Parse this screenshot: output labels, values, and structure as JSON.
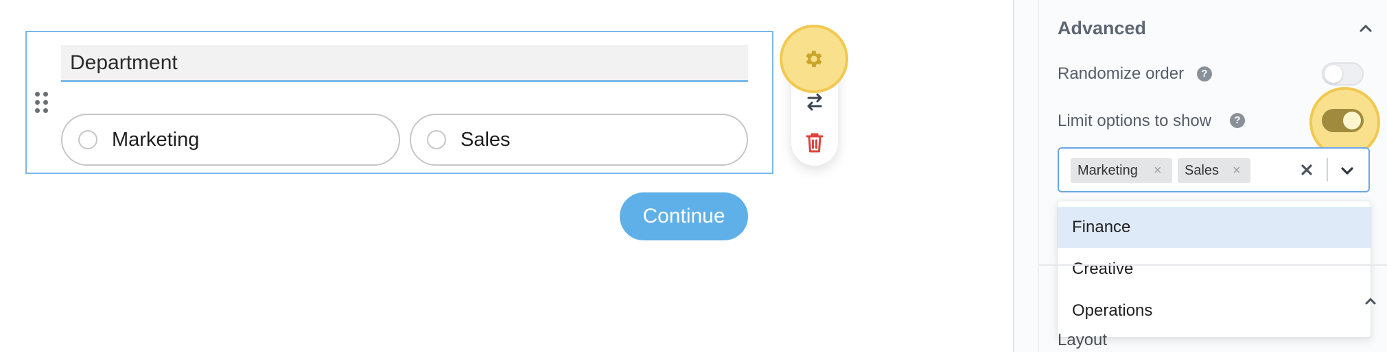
{
  "editor": {
    "question_title": "Department",
    "options": [
      "Marketing",
      "Sales"
    ],
    "continue_label": "Continue"
  },
  "toolbar": {
    "icons": [
      "gear-icon",
      "swap-icon",
      "trash-icon"
    ]
  },
  "panel": {
    "section_title": "Advanced",
    "randomize_label": "Randomize order",
    "randomize_enabled": false,
    "limit_label": "Limit options to show",
    "limit_enabled": true,
    "help_glyph": "?",
    "selected_chips": [
      "Marketing",
      "Sales"
    ],
    "chip_remove_glyph": "×",
    "dropdown_options": [
      "Finance",
      "Creative",
      "Operations"
    ],
    "layout_label": "Layout"
  },
  "colors": {
    "accent_blue": "#7ab8ea",
    "continue_blue": "#5fb0e8",
    "highlight_yellow": "#f8e08d",
    "toggle_on": "#a08a3e",
    "trash_red": "#e0413a"
  }
}
